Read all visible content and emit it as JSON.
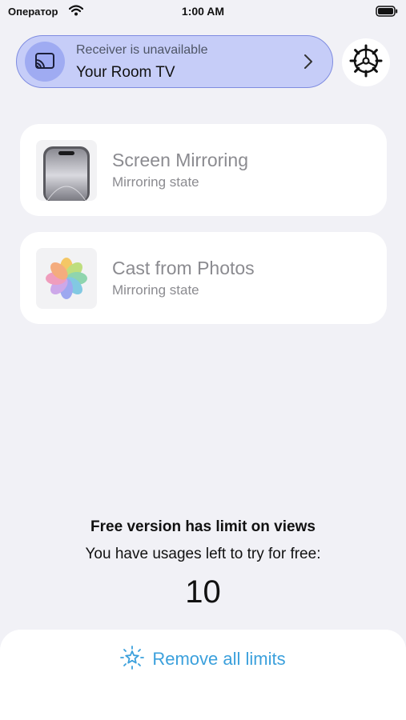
{
  "status_bar": {
    "carrier": "Оператор",
    "time": "1:00 AM"
  },
  "receiver": {
    "status": "Receiver is unavailable",
    "name": "Your Room TV",
    "accent_color": "#c6cdf8",
    "icon": "cast-icon"
  },
  "settings": {
    "icon": "gear-icon"
  },
  "features": [
    {
      "title": "Screen Mirroring",
      "subtitle": "Mirroring state",
      "icon": "phone-icon"
    },
    {
      "title": "Cast from Photos",
      "subtitle": "Mirroring state",
      "icon": "photos-icon"
    }
  ],
  "limits": {
    "title": "Free version has limit on views",
    "subtitle": "You have usages left to try for free:",
    "count": "10"
  },
  "upgrade": {
    "label": "Remove all limits",
    "color": "#3ba0dc",
    "icon": "sparkle-star-icon"
  }
}
